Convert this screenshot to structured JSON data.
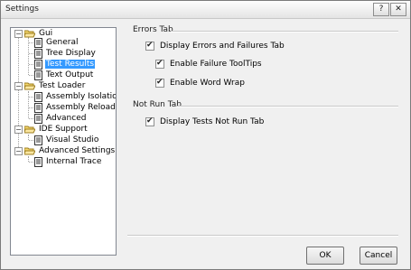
{
  "window": {
    "title": "Settings",
    "help_glyph": "?",
    "close_glyph": "✕"
  },
  "tree": {
    "nodes": [
      {
        "label": "Gui",
        "expander": "−"
      },
      {
        "label": "General"
      },
      {
        "label": "Tree Display"
      },
      {
        "label": "Test Results",
        "selected": true
      },
      {
        "label": "Text Output"
      },
      {
        "label": "Test Loader",
        "expander": "−"
      },
      {
        "label": "Assembly Isolation"
      },
      {
        "label": "Assembly Reload"
      },
      {
        "label": "Advanced"
      },
      {
        "label": "IDE Support",
        "expander": "−"
      },
      {
        "label": "Visual Studio"
      },
      {
        "label": "Advanced Settings",
        "expander": "−"
      },
      {
        "label": "Internal Trace"
      }
    ],
    "icons": {
      "folder": "open-folder-icon",
      "page": "page-icon"
    },
    "selection_color": "#3399ff"
  },
  "errors_tab": {
    "title": "Errors Tab",
    "display_errors": {
      "label": "Display Errors and Failures Tab",
      "checked": true
    },
    "failure_tooltips": {
      "label": "Enable Failure ToolTips",
      "checked": true
    },
    "word_wrap": {
      "label": "Enable Word Wrap",
      "checked": true
    }
  },
  "not_run_tab": {
    "title": "Not Run Tab",
    "display_not_run": {
      "label": "Display Tests Not Run Tab",
      "checked": true
    }
  },
  "checkmark_glyph": "✔",
  "buttons": {
    "ok": "OK",
    "cancel": "Cancel"
  }
}
